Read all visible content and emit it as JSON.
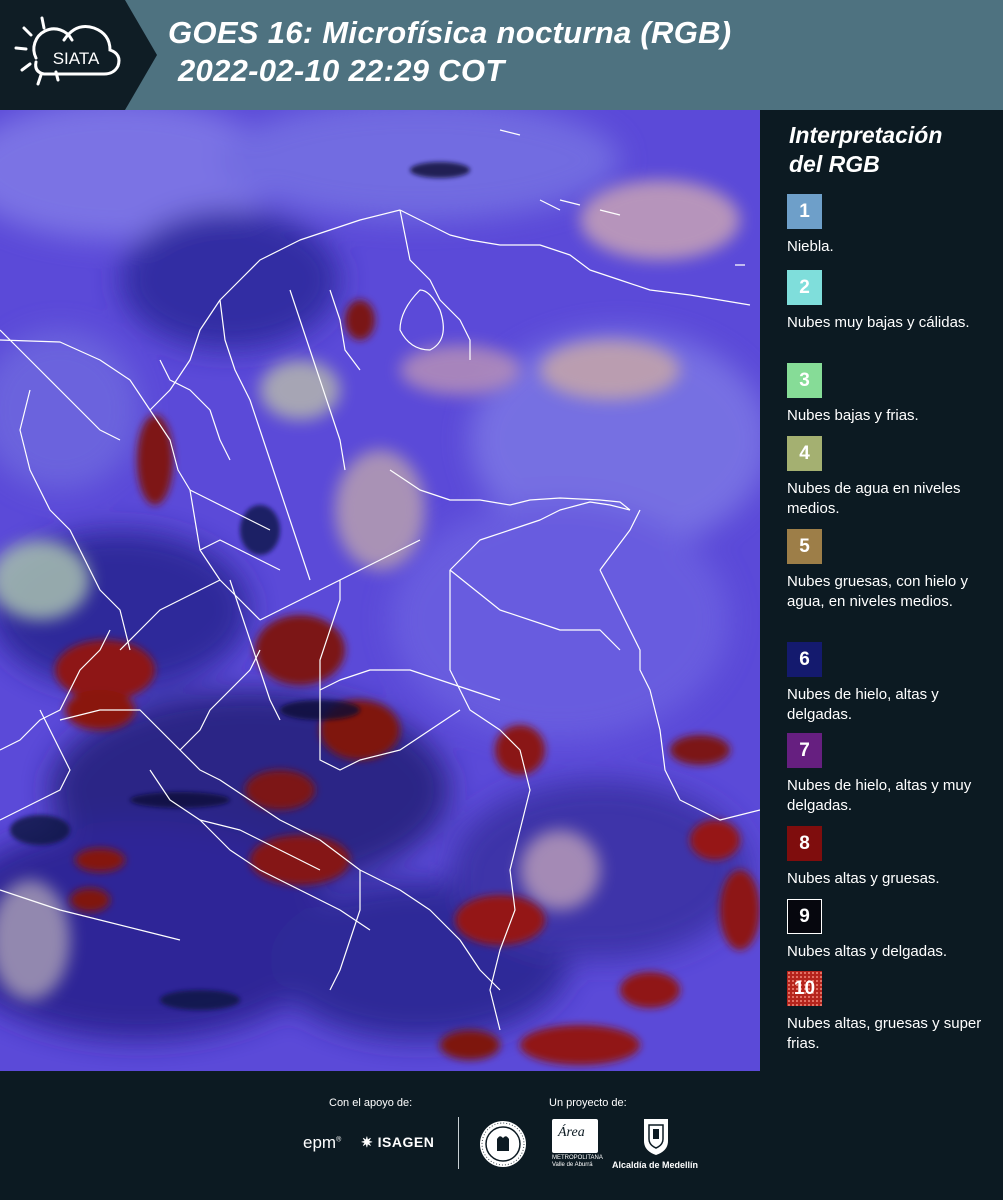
{
  "header": {
    "logo_text": "SIATA",
    "title_line1": "GOES 16: Microfísica nocturna (RGB)",
    "title_line2": "2022-02-10 22:29 COT"
  },
  "legend": {
    "title_line1": "Interpretación",
    "title_line2": "del RGB",
    "items": [
      {
        "number": "1",
        "label": "Niebla.",
        "color": "#6e9fc9"
      },
      {
        "number": "2",
        "label": "Nubes muy bajas y cálidas.",
        "color": "#7fdedb"
      },
      {
        "number": "3",
        "label": "Nubes bajas y frias.",
        "color": "#86dc97"
      },
      {
        "number": "4",
        "label": "Nubes de agua en niveles medios.",
        "color": "#a4b071"
      },
      {
        "number": "5",
        "label": "Nubes gruesas, con hielo y agua, en niveles medios.",
        "color": "#9d7e48"
      },
      {
        "number": "6",
        "label": "Nubes de hielo, altas y delgadas.",
        "color": "#141a6e"
      },
      {
        "number": "7",
        "label": "Nubes de hielo, altas y muy delgadas.",
        "color": "#661f80"
      },
      {
        "number": "8",
        "label": "Nubes altas y gruesas.",
        "color": "#7f0d0d"
      },
      {
        "number": "9",
        "label": "Nubes altas y delgadas.",
        "color": "#06070e"
      },
      {
        "number": "10",
        "label": "Nubes altas, gruesas y super frias.",
        "color": "#b5241c"
      }
    ]
  },
  "footer": {
    "support_label": "Con el apoyo de:",
    "project_label": "Un proyecto de:",
    "epm_text": "epm",
    "isagen_text": "ISAGEN",
    "area_text": "Área",
    "area_sub1": "METROPOLITANA",
    "area_sub2": "Valle de Aburrá",
    "alcaldia_text": "Alcaldía de Medellín"
  }
}
